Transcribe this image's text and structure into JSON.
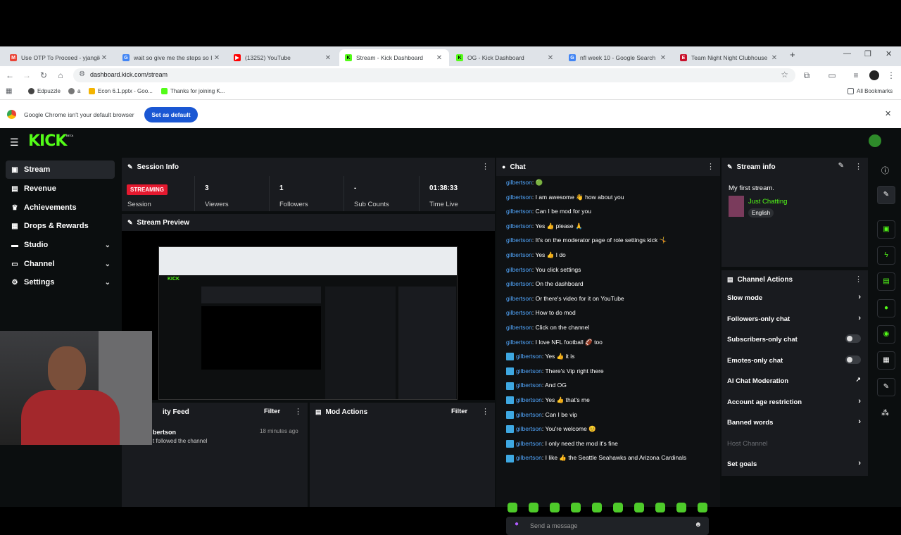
{
  "browser": {
    "tabs": [
      {
        "title": "Use OTP To Proceed - yjangikh",
        "icon": "gmail-icon",
        "color": "#ea4335"
      },
      {
        "title": "wait so give me the steps so I c",
        "icon": "google-icon",
        "color": "#4285f4"
      },
      {
        "title": "(13252) YouTube",
        "icon": "youtube-icon",
        "color": "#ff0000"
      },
      {
        "title": "Stream - Kick Dashboard",
        "icon": "kick-icon",
        "color": "#53fc18"
      },
      {
        "title": "OG - Kick Dashboard",
        "icon": "kick-icon",
        "color": "#53fc18"
      },
      {
        "title": "nfl week 10 - Google Search",
        "icon": "google-icon",
        "color": "#4285f4"
      },
      {
        "title": "Team Night Night Clubhouse",
        "icon": "espn-icon",
        "color": "#c9102b"
      }
    ],
    "url": "dashboard.kick.com/stream",
    "bookmarks": [
      "Edpuzzle",
      "a",
      "Econ 6.1.pptx - Goo...",
      "Thanks for joining K..."
    ],
    "all_bookmarks": "All Bookmarks",
    "infobar_text": "Google Chrome isn't your default browser",
    "set_default": "Set as default"
  },
  "kick": {
    "logo": "KICK",
    "logo_tag": "BETA",
    "sidebar": [
      {
        "label": "Stream",
        "icon": "stream-icon",
        "active": true
      },
      {
        "label": "Revenue",
        "icon": "revenue-icon"
      },
      {
        "label": "Achievements",
        "icon": "trophy-icon"
      },
      {
        "label": "Drops & Rewards",
        "icon": "gift-icon"
      },
      {
        "label": "Studio",
        "icon": "studio-icon",
        "chevron": true
      },
      {
        "label": "Channel",
        "icon": "channel-icon",
        "chevron": true
      },
      {
        "label": "Settings",
        "icon": "gear-icon",
        "chevron": true
      }
    ],
    "session": {
      "title": "Session Info",
      "status": "STREAMING",
      "status_label": "Session",
      "stats": [
        {
          "value": "3",
          "label": "Viewers"
        },
        {
          "value": "1",
          "label": "Followers"
        },
        {
          "value": "-",
          "label": "Sub Counts"
        },
        {
          "value": "01:38:33",
          "label": "Time Live"
        }
      ]
    },
    "preview": {
      "title": "Stream Preview"
    },
    "activity": {
      "title": "ity Feed",
      "filter": "Filter",
      "item_user": "bertson",
      "item_text": "t followed the channel",
      "item_time": "18 minutes ago"
    },
    "mod_actions": {
      "title": "Mod Actions",
      "filter": "Filter"
    },
    "chat": {
      "title": "Chat",
      "placeholder": "Send a message",
      "messages": [
        {
          "user": "gilbertson",
          "text": "🟢",
          "badge": false
        },
        {
          "user": "gilbertson",
          "text": "I am awesome 👋 how about you",
          "badge": false
        },
        {
          "user": "gilbertson",
          "text": "Can I be mod for you",
          "badge": false
        },
        {
          "user": "gilbertson",
          "text": "Yes 👍 please 🙏",
          "badge": false
        },
        {
          "user": "gilbertson",
          "text": "It's on the moderator page of role settings kick 🤸",
          "badge": false
        },
        {
          "user": "gilbertson",
          "text": "Yes 👍 I do",
          "badge": false
        },
        {
          "user": "gilbertson",
          "text": "You click settings",
          "badge": false
        },
        {
          "user": "gilbertson",
          "text": "On the dashboard",
          "badge": false
        },
        {
          "user": "gilbertson",
          "text": "Or there's video for it on YouTube",
          "badge": false
        },
        {
          "user": "gilbertson",
          "text": "How to do mod",
          "badge": false
        },
        {
          "user": "gilbertson",
          "text": "Click on the channel",
          "badge": false
        },
        {
          "user": "gilbertson",
          "text": "I love NFL football 🏈 too",
          "badge": false
        },
        {
          "user": "gilbertson",
          "text": "Yes 👍 it is",
          "badge": true
        },
        {
          "user": "gilbertson",
          "text": "There's Vip right there",
          "badge": true
        },
        {
          "user": "gilbertson",
          "text": "And OG",
          "badge": true
        },
        {
          "user": "gilbertson",
          "text": "Yes 👍 that's me",
          "badge": true
        },
        {
          "user": "gilbertson",
          "text": "Can I be vip",
          "badge": true
        },
        {
          "user": "gilbertson",
          "text": "You're welcome 😊",
          "badge": true
        },
        {
          "user": "gilbertson",
          "text": "I only need the mod it's fine",
          "badge": true
        },
        {
          "user": "gilbertson",
          "text": "I like 👍 the Seattle Seahawks and Arizona Cardinals",
          "badge": true
        }
      ]
    },
    "stream_info": {
      "title": "Stream info",
      "stream_title": "My first stream.",
      "category": "Just Chatting",
      "language": "English"
    },
    "channel_actions": {
      "title": "Channel Actions",
      "items": [
        {
          "label": "Slow mode",
          "control": "arrow"
        },
        {
          "label": "Followers-only chat",
          "control": "arrow"
        },
        {
          "label": "Subscribers-only chat",
          "control": "toggle"
        },
        {
          "label": "Emotes-only chat",
          "control": "toggle"
        },
        {
          "label": "AI Chat Moderation",
          "control": "external"
        },
        {
          "label": "Account age restriction",
          "control": "arrow"
        },
        {
          "label": "Banned words",
          "control": "arrow"
        },
        {
          "label": "Host Channel",
          "control": "none",
          "disabled": true
        },
        {
          "label": "Set goals",
          "control": "arrow"
        }
      ]
    },
    "accent": "#53fc18"
  }
}
